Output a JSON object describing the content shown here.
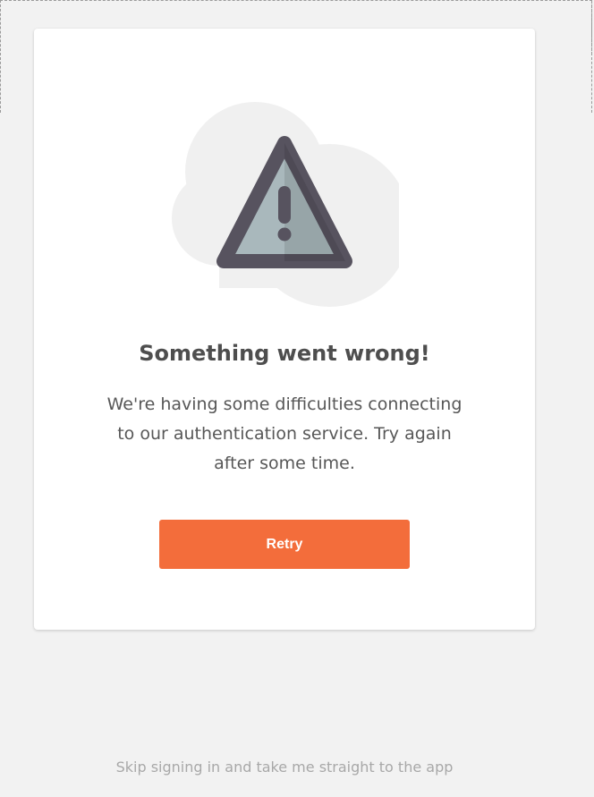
{
  "error_card": {
    "title": "Something went wrong!",
    "message": "We're having some difficulties connecting to our authentication service. Try again after some time.",
    "retry_label": "Retry",
    "illustration_icon": "warning-triangle-icon"
  },
  "footer": {
    "skip_label": "Skip signing in and take me straight to the app"
  },
  "colors": {
    "background": "#f2f2f2",
    "card": "#ffffff",
    "accent": "#f36d3b",
    "title_text": "#4e4e4e",
    "body_text": "#575757",
    "link_text": "#a8a8a8",
    "cloud": "#f0f0f0",
    "triangle_border": "#57535f",
    "triangle_fill": "#a9b8bc"
  }
}
